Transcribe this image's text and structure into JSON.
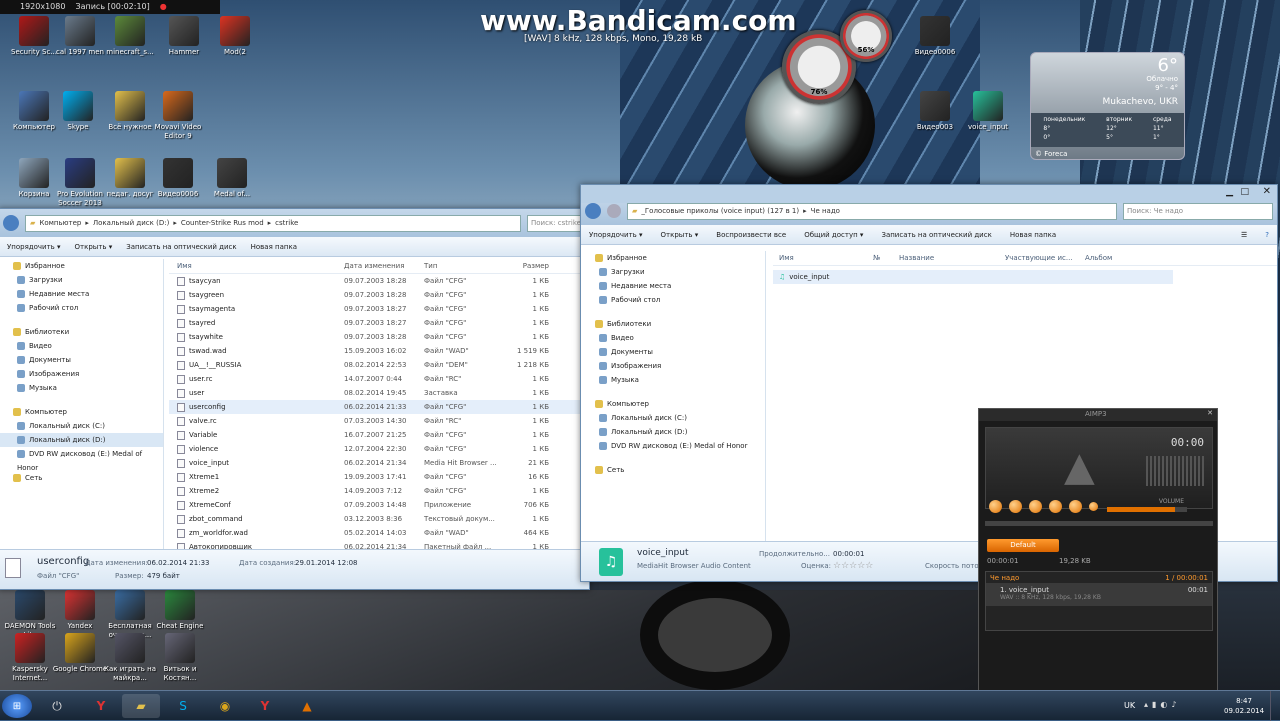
{
  "recorder": {
    "res": "1920x1080",
    "rec": "Запись [00:02:10]"
  },
  "overlay": {
    "title": "www.Bandicam.com",
    "sub": "[WAV] 8 kHz, 128 kbps, Mono, 19,28 kB"
  },
  "gadgets": {
    "cpu": "76%",
    "mem": "56%"
  },
  "weather": {
    "temp": "6°",
    "desc": "Облачно",
    "range": "9° - 4°",
    "city": "Mukachevo, UKR",
    "days": [
      {
        "name": "понедельник",
        "hi": "8°",
        "lo": "0°"
      },
      {
        "name": "вторник",
        "hi": "12°",
        "lo": "5°"
      },
      {
        "name": "среда",
        "hi": "11°",
        "lo": "1°"
      }
    ],
    "source": "© Foreca"
  },
  "desktop_icons": [
    {
      "label": "Security Sc...",
      "color": "#b01818"
    },
    {
      "label": "cal 1997 men",
      "color": "#6a7b8c"
    },
    {
      "label": "minecraft_s...",
      "color": "#5c8a3a"
    },
    {
      "label": "Hammer",
      "color": "#555"
    },
    {
      "label": "Mod(2",
      "color": "#d32"
    },
    {
      "label": "Компьютер",
      "color": "#4b77b8"
    },
    {
      "label": "Skype",
      "color": "#00aff0"
    },
    {
      "label": "Всё нужное",
      "color": "#e2c04c"
    },
    {
      "label": "Movavi Video Editor 9",
      "color": "#d8691c"
    },
    {
      "label": "Корзина",
      "color": "#8fa7bd"
    },
    {
      "label": "Pro Evolution Soccer 2013",
      "color": "#2a3d82"
    },
    {
      "label": "педаг. досуг",
      "color": "#e2c04c"
    },
    {
      "label": "Видео0006",
      "color": "#333"
    },
    {
      "label": "Medal of...",
      "color": "#444"
    },
    {
      "label": "Видео0006",
      "color": "#333"
    },
    {
      "label": "Видео003",
      "color": "#444"
    },
    {
      "label": "voice_input",
      "color": "#27c19b"
    },
    {
      "label": "DAEMON Tools Lite",
      "color": "#2b4a6d"
    },
    {
      "label": "Yandex",
      "color": "#d33"
    },
    {
      "label": "Бесплатная очистка р...",
      "color": "#3a6ea5"
    },
    {
      "label": "Cheat Engine",
      "color": "#2b8a3e"
    },
    {
      "label": "Kaspersky Internet...",
      "color": "#c22"
    },
    {
      "label": "Google Chrome",
      "color": "#d9a51c"
    },
    {
      "label": "Как играть на майкра...",
      "color": "#556"
    },
    {
      "label": "Витьок и Костян...",
      "color": "#667"
    }
  ],
  "left_window": {
    "path": [
      "Компьютер",
      "Локальный диск (D:)",
      "Counter-Strike Rus mod",
      "cstrike"
    ],
    "search": "Поиск: cstrike",
    "toolbar": [
      "Упорядочить ▾",
      "Открыть ▾",
      "Записать на оптический диск",
      "Новая папка"
    ],
    "nav": [
      {
        "label": "Избранное",
        "sub": false,
        "sel": false
      },
      {
        "label": "Загрузки",
        "sub": true,
        "sel": false
      },
      {
        "label": "Недавние места",
        "sub": true,
        "sel": false
      },
      {
        "label": "Рабочий стол",
        "sub": true,
        "sel": false
      },
      {
        "label": "",
        "gap": true
      },
      {
        "label": "Библиотеки",
        "sub": false,
        "sel": false
      },
      {
        "label": "Видео",
        "sub": true,
        "sel": false
      },
      {
        "label": "Документы",
        "sub": true,
        "sel": false
      },
      {
        "label": "Изображения",
        "sub": true,
        "sel": false
      },
      {
        "label": "Музыка",
        "sub": true,
        "sel": false
      },
      {
        "label": "",
        "gap": true
      },
      {
        "label": "Компьютер",
        "sub": false,
        "sel": false
      },
      {
        "label": "Локальный диск (C:)",
        "sub": true,
        "sel": false
      },
      {
        "label": "Локальный диск (D:)",
        "sub": true,
        "sel": true
      },
      {
        "label": "DVD RW дисковод (E:) Medal of Honor",
        "sub": true,
        "sel": false
      },
      {
        "label": "",
        "gap": true
      },
      {
        "label": "Сеть",
        "sub": false,
        "sel": false
      }
    ],
    "columns": [
      "Имя",
      "Дата изменения",
      "Тип",
      "Размер"
    ],
    "rows": [
      [
        "tsaycyan",
        "09.07.2003 18:28",
        "Файл \"CFG\"",
        "1 КБ"
      ],
      [
        "tsaygreen",
        "09.07.2003 18:28",
        "Файл \"CFG\"",
        "1 КБ"
      ],
      [
        "tsaymagenta",
        "09.07.2003 18:27",
        "Файл \"CFG\"",
        "1 КБ"
      ],
      [
        "tsayred",
        "09.07.2003 18:27",
        "Файл \"CFG\"",
        "1 КБ"
      ],
      [
        "tsaywhite",
        "09.07.2003 18:28",
        "Файл \"CFG\"",
        "1 КБ"
      ],
      [
        "tswad.wad",
        "15.09.2003 16:02",
        "Файл \"WAD\"",
        "1 519 КБ"
      ],
      [
        "UA__!__RUSSIA",
        "08.02.2014 22:53",
        "Файл \"DEM\"",
        "1 218 КБ"
      ],
      [
        "user.rc",
        "14.07.2007 0:44",
        "Файл \"RC\"",
        "1 КБ"
      ],
      [
        "user",
        "08.02.2014 19:45",
        "Заставка",
        "1 КБ"
      ],
      [
        "userconfig",
        "06.02.2014 21:33",
        "Файл \"CFG\"",
        "1 КБ"
      ],
      [
        "valve.rc",
        "07.03.2003 14:30",
        "Файл \"RC\"",
        "1 КБ"
      ],
      [
        "Variable",
        "16.07.2007 21:25",
        "Файл \"CFG\"",
        "1 КБ"
      ],
      [
        "violence",
        "12.07.2004 22:30",
        "Файл \"CFG\"",
        "1 КБ"
      ],
      [
        "voice_input",
        "06.02.2014 21:34",
        "Media Hit Browser ...",
        "21 КБ"
      ],
      [
        "Xtreme1",
        "19.09.2003 17:41",
        "Файл \"CFG\"",
        "16 КБ"
      ],
      [
        "Xtreme2",
        "14.09.2003 7:12",
        "Файл \"CFG\"",
        "1 КБ"
      ],
      [
        "XtremeConf",
        "07.09.2003 14:48",
        "Приложение",
        "706 КБ"
      ],
      [
        "zbot_command",
        "03.12.2003 8:36",
        "Текстовый докум...",
        "1 КБ"
      ],
      [
        "zm_worldfor.wad",
        "05.02.2014 14:03",
        "Файл \"WAD\"",
        "464 КБ"
      ],
      [
        "Автокопировщик",
        "06.02.2014 21:34",
        "Пакетный файл ...",
        "1 КБ"
      ]
    ],
    "details": {
      "name": "userconfig",
      "type": "Файл \"CFG\"",
      "mod_label": "Дата изменения:",
      "mod": "06.02.2014 21:33",
      "created_label": "Дата создания:",
      "created": "29.01.2014 12:08",
      "size_label": "Размер:",
      "size": "479 байт"
    }
  },
  "right_window": {
    "path": [
      "_Голосовые приколы (voice input) (127 в 1)",
      "Че надо"
    ],
    "search": "Поиск: Че надо",
    "toolbar": [
      "Упорядочить ▾",
      "Открыть ▾",
      "Воспроизвести все",
      "Общий доступ ▾",
      "Записать на оптический диск",
      "Новая папка"
    ],
    "nav": [
      {
        "label": "Избранное",
        "sub": false
      },
      {
        "label": "Загрузки",
        "sub": true
      },
      {
        "label": "Недавние места",
        "sub": true
      },
      {
        "label": "Рабочий стол",
        "sub": true
      },
      {
        "label": "",
        "gap": true
      },
      {
        "label": "Библиотеки",
        "sub": false
      },
      {
        "label": "Видео",
        "sub": true
      },
      {
        "label": "Документы",
        "sub": true
      },
      {
        "label": "Изображения",
        "sub": true
      },
      {
        "label": "Музыка",
        "sub": true
      },
      {
        "label": "",
        "gap": true
      },
      {
        "label": "Компьютер",
        "sub": false
      },
      {
        "label": "Локальный диск (C:)",
        "sub": true
      },
      {
        "label": "Локальный диск (D:)",
        "sub": true
      },
      {
        "label": "DVD RW дисковод (E:) Medal of Honor",
        "sub": true
      },
      {
        "label": "",
        "gap": true
      },
      {
        "label": "Сеть",
        "sub": false
      }
    ],
    "columns": [
      "Имя",
      "№",
      "Название",
      "Участвующие ис...",
      "Альбом"
    ],
    "file": "voice_input",
    "details": {
      "name": "voice_input",
      "type": "MediaHit Browser Audio Content",
      "dur_label": "Продолжительно...",
      "dur": "00:00:01",
      "rate_label": "Оценка:",
      "stars": "☆☆☆☆☆",
      "speed_label": "Скорость пото"
    }
  },
  "aimp": {
    "title": "AIMP3",
    "time": "00:00",
    "volume_label": "VOLUME",
    "preset": "Default",
    "pos": "00:00:01",
    "total": "19,28 KB",
    "playlist_header": "Че надо",
    "playlist_count": "1 / 00:00:01",
    "track": "1. voice_input",
    "track_time": "00:01",
    "track_info": "WAV :: 8 KHz, 128 kbps, 19,28 KB"
  },
  "taskbar": {
    "lang": "UK",
    "time": "8:47",
    "date": "09.02.2014"
  }
}
